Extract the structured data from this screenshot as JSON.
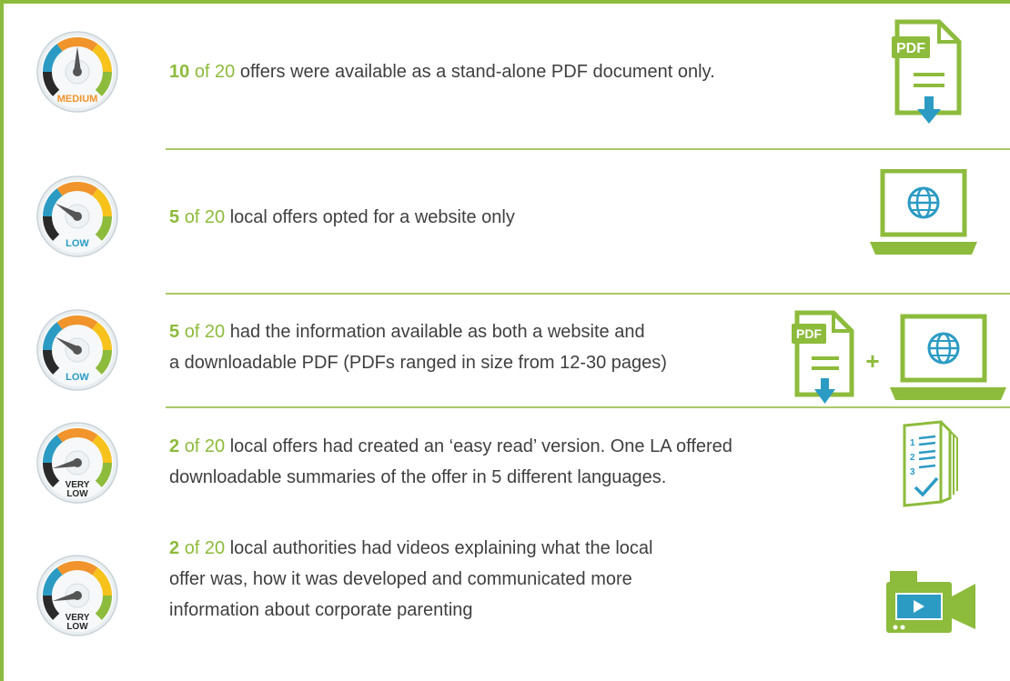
{
  "rows": [
    {
      "num": "10",
      "of_total": "of 20",
      "text": " offers were available as a stand-alone PDF document only.",
      "gauge_label": "MEDIUM",
      "gauge_label_2": "",
      "level": 0.5,
      "icon": "pdf-download-icon"
    },
    {
      "num": "5",
      "of_total": "of 20",
      "text": " local offers opted for a website only",
      "gauge_label": "LOW",
      "gauge_label_2": "",
      "level": 0.28,
      "icon": "laptop-globe-icon"
    },
    {
      "num": "5",
      "of_total": "of 20",
      "text": " had the information available as both a website and",
      "text_2": "a downloadable PDF (PDFs ranged in size from 12-30 pages)",
      "gauge_label": "LOW",
      "gauge_label_2": "",
      "level": 0.28,
      "icon": "pdf-plus-laptop-icon"
    },
    {
      "num": "2",
      "of_total": "of 20",
      "text": " local offers had created an ‘easy read’ version. One LA offered",
      "text_2": "downloadable summaries of the offer in 5 different languages.",
      "gauge_label": "VERY",
      "gauge_label_2": "LOW",
      "level": 0.12,
      "icon": "easy-read-booklet-icon"
    },
    {
      "num": "2",
      "of_total": "of 20",
      "text": " local authorities had videos explaining what the local",
      "text_2": "offer was, how it was developed and communicated more",
      "text_3": "information about corporate parenting",
      "gauge_label": "VERY",
      "gauge_label_2": "LOW",
      "level": 0.12,
      "icon": "video-camera-icon"
    }
  ],
  "icons": {
    "pdf_label": "PDF",
    "plus": "+"
  },
  "colors": {
    "accent": "#8dbb3c",
    "teal": "#2b9bc4",
    "orange": "#f0942b",
    "yellow": "#f7c21b",
    "dark": "#2a2a2a"
  }
}
